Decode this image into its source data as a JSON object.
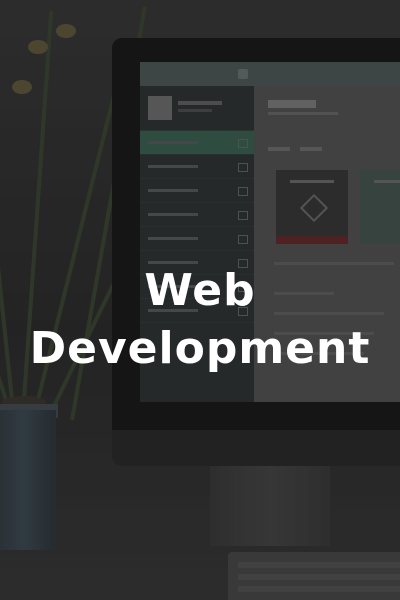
{
  "headline": {
    "line1": "Web",
    "line2": "Development"
  },
  "colors": {
    "headline_text": "#ffffff",
    "background": "#2b2b2b",
    "active_accent": "#3e6a5a"
  }
}
